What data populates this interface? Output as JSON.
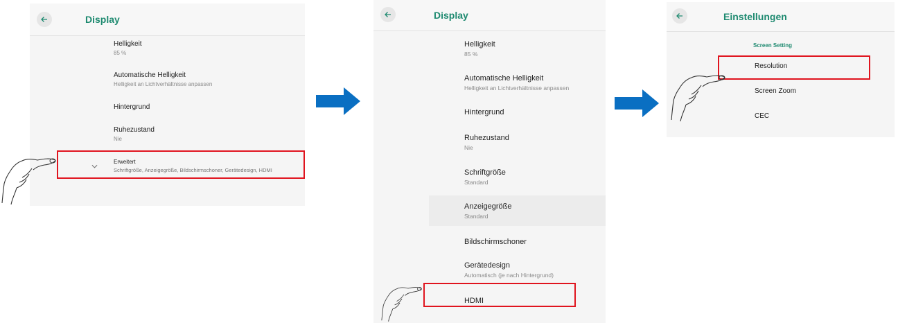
{
  "colors": {
    "accent": "#1e8a70",
    "highlight": "#e0141e",
    "arrow": "#0a6fc2"
  },
  "panel1": {
    "title": "Display",
    "back_icon": "arrow-left-icon",
    "items": [
      {
        "title": "Helligkeit",
        "subtitle": "85 %"
      },
      {
        "title": "Automatische Helligkeit",
        "subtitle": "Helligkeit an Lichtverhältnisse anpassen"
      },
      {
        "title": "Hintergrund",
        "subtitle": ""
      },
      {
        "title": "Ruhezustand",
        "subtitle": "Nie"
      },
      {
        "title": "Erweitert",
        "subtitle": "Schriftgröße, Anzeigegröße, Bildschirmschoner, Gerätedesign, HDMI"
      }
    ],
    "expand_icon": "chevron-down-icon"
  },
  "panel2": {
    "title": "Display",
    "back_icon": "arrow-left-icon",
    "items": [
      {
        "title": "Helligkeit",
        "subtitle": "85 %"
      },
      {
        "title": "Automatische Helligkeit",
        "subtitle": "Helligkeit an Lichtverhältnisse anpassen"
      },
      {
        "title": "Hintergrund",
        "subtitle": ""
      },
      {
        "title": "Ruhezustand",
        "subtitle": "Nie"
      },
      {
        "title": "Schriftgröße",
        "subtitle": "Standard"
      },
      {
        "title": "Anzeigegröße",
        "subtitle": "Standard"
      },
      {
        "title": "Bildschirmschoner",
        "subtitle": ""
      },
      {
        "title": "Gerätedesign",
        "subtitle": "Automatisch (je nach Hintergrund)"
      },
      {
        "title": "HDMI",
        "subtitle": ""
      }
    ]
  },
  "panel3": {
    "title": "Einstellungen",
    "back_icon": "arrow-left-icon",
    "section": "Screen Setting",
    "items": [
      {
        "title": "Resolution"
      },
      {
        "title": "Screen Zoom"
      },
      {
        "title": "CEC"
      }
    ]
  },
  "annotations": {
    "arrow_icon": "arrow-right-icon",
    "hand_icon": "pointing-hand-icon"
  }
}
